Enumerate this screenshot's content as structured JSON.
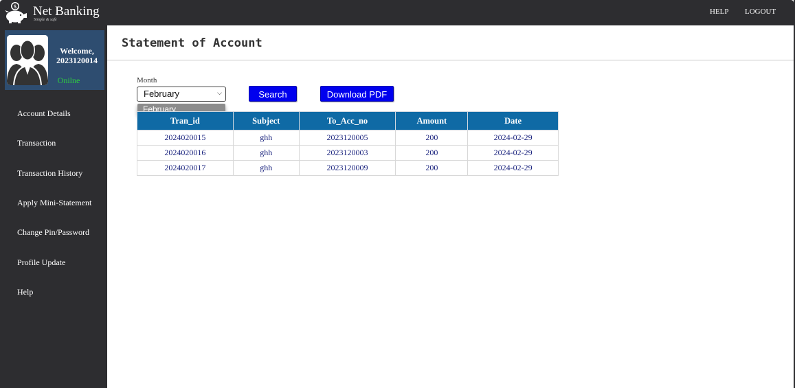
{
  "app": {
    "brand": "Net Banking",
    "tagline": "Simple & safe",
    "nav_right": [
      "HELP",
      "LOGOUT"
    ]
  },
  "profile": {
    "welcome": "Welcome,",
    "user_id": "2023120014",
    "status": "Onilne"
  },
  "sidebar": {
    "items": [
      {
        "label": "Account Details"
      },
      {
        "label": "Transaction"
      },
      {
        "label": "Transaction History"
      },
      {
        "label": "Apply Mini-Statement"
      },
      {
        "label": "Change Pin/Password"
      },
      {
        "label": "Profile Update"
      },
      {
        "label": "Help"
      }
    ]
  },
  "page": {
    "title": "Statement of Account",
    "month_label": "Month",
    "month_selected": "February",
    "dropdown_options": [
      "February"
    ],
    "search_label": "Search",
    "pdf_label": "Download PDF"
  },
  "table": {
    "headers": [
      "Tran_id",
      "Subject",
      "To_Acc_no",
      "Amount",
      "Date"
    ],
    "rows": [
      [
        "2024020015",
        "ghh",
        "2023120005",
        "200",
        "2024-02-29"
      ],
      [
        "2024020016",
        "ghh",
        "2023120003",
        "200",
        "2024-02-29"
      ],
      [
        "2024020017",
        "ghh",
        "2023120009",
        "200",
        "2024-02-29"
      ]
    ]
  },
  "colors": {
    "dark_bg": "#2d2d30",
    "profile_bg": "#2e4d70",
    "table_header": "#0f6aa5",
    "button": "#0000ee",
    "online": "#2ecc40"
  },
  "icons": {
    "logo": "piggy-bank-icon",
    "avatar": "user-group-icon",
    "select_arrow": "chevron-down-icon"
  }
}
